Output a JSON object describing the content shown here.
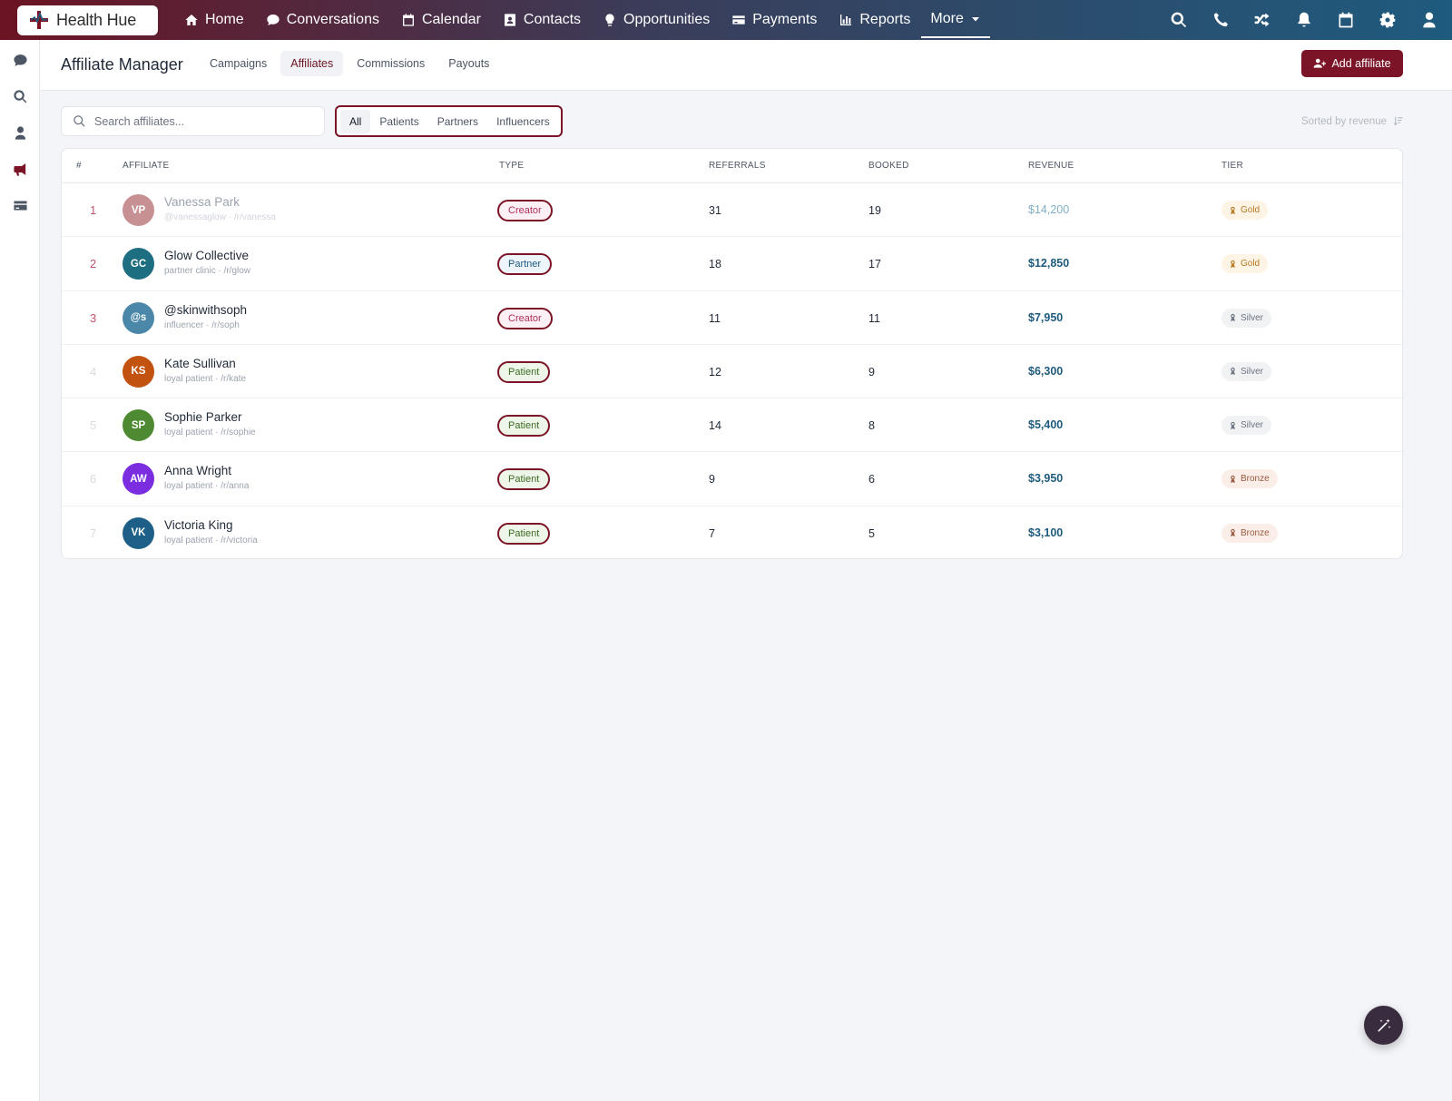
{
  "brand": {
    "name": "Health Hue"
  },
  "nav": {
    "links": [
      {
        "label": "Home",
        "icon": "home-icon"
      },
      {
        "label": "Conversations",
        "icon": "chat-icon"
      },
      {
        "label": "Calendar",
        "icon": "calendar-icon"
      },
      {
        "label": "Contacts",
        "icon": "contact-card-icon"
      },
      {
        "label": "Opportunities",
        "icon": "lightbulb-icon"
      },
      {
        "label": "Payments",
        "icon": "credit-card-icon"
      },
      {
        "label": "Reports",
        "icon": "bar-chart-icon"
      }
    ],
    "more_label": "More",
    "right_icons": [
      "search-icon",
      "phone-icon",
      "shuffle-icon",
      "bell-icon",
      "calendar-icon",
      "gear-icon",
      "user-icon"
    ]
  },
  "rail": {
    "icons": [
      "chat-icon",
      "search-icon",
      "user-icon",
      "megaphone-icon",
      "credit-card-icon"
    ],
    "active": "megaphone-icon"
  },
  "header": {
    "title": "Affiliate Manager",
    "tabs": [
      {
        "label": "Campaigns"
      },
      {
        "label": "Affiliates"
      },
      {
        "label": "Commissions"
      },
      {
        "label": "Payouts"
      }
    ],
    "active_tab": "Affiliates",
    "add_button_label": "Add affiliate"
  },
  "toolbar": {
    "search_placeholder": "Search affiliates...",
    "search_value": "",
    "filters": [
      {
        "label": "All"
      },
      {
        "label": "Patients"
      },
      {
        "label": "Partners"
      },
      {
        "label": "Influencers"
      }
    ],
    "active_filter": "All",
    "sort_label": "Sorted by revenue"
  },
  "table": {
    "columns": {
      "rank": "#",
      "affiliate": "AFFILIATE",
      "type": "TYPE",
      "referrals": "REFERRALS",
      "booked": "BOOKED",
      "revenue": "REVENUE",
      "tier": "TIER"
    },
    "rows": [
      {
        "rank": "1",
        "initials": "VP",
        "name": "Vanessa Park",
        "sub": "@vanessaglow · /r/vanessa",
        "type": "Creator",
        "referrals": "31",
        "booked": "19",
        "revenue": "$14,200",
        "tier": "Gold"
      },
      {
        "rank": "2",
        "initials": "GC",
        "name": "Glow Collective",
        "sub": "partner clinic · /r/glow",
        "type": "Partner",
        "referrals": "18",
        "booked": "17",
        "revenue": "$12,850",
        "tier": "Gold"
      },
      {
        "rank": "3",
        "initials": "@s",
        "name": "@skinwithsoph",
        "sub": "influencer · /r/soph",
        "type": "Creator",
        "referrals": "11",
        "booked": "11",
        "revenue": "$7,950",
        "tier": "Silver"
      },
      {
        "rank": "4",
        "initials": "KS",
        "name": "Kate Sullivan",
        "sub": "loyal patient · /r/kate",
        "type": "Patient",
        "referrals": "12",
        "booked": "9",
        "revenue": "$6,300",
        "tier": "Silver"
      },
      {
        "rank": "5",
        "initials": "SP",
        "name": "Sophie Parker",
        "sub": "loyal patient · /r/sophie",
        "type": "Patient",
        "referrals": "14",
        "booked": "8",
        "revenue": "$5,400",
        "tier": "Silver"
      },
      {
        "rank": "6",
        "initials": "AW",
        "name": "Anna Wright",
        "sub": "loyal patient · /r/anna",
        "type": "Patient",
        "referrals": "9",
        "booked": "6",
        "revenue": "$3,950",
        "tier": "Bronze"
      },
      {
        "rank": "7",
        "initials": "VK",
        "name": "Victoria King",
        "sub": "loyal patient · /r/victoria",
        "type": "Patient",
        "referrals": "7",
        "booked": "5",
        "revenue": "$3,100",
        "tier": "Bronze"
      }
    ]
  },
  "colors": {
    "accent": "#7a1426",
    "revenue": "#1e5b7e",
    "avatar_vp": "#c79193",
    "avatar_gc": "#1e6e82",
    "avatar_s": "#4a87a8",
    "avatar_ks": "#c2520f",
    "avatar_sp": "#4e8a32",
    "avatar_aw": "#7a2ee0",
    "avatar_vk": "#1d5f86",
    "rank_top": "#c0556b",
    "rank_rest": "#d7dbe0"
  },
  "fab": {
    "icon": "magic-wand-icon"
  }
}
